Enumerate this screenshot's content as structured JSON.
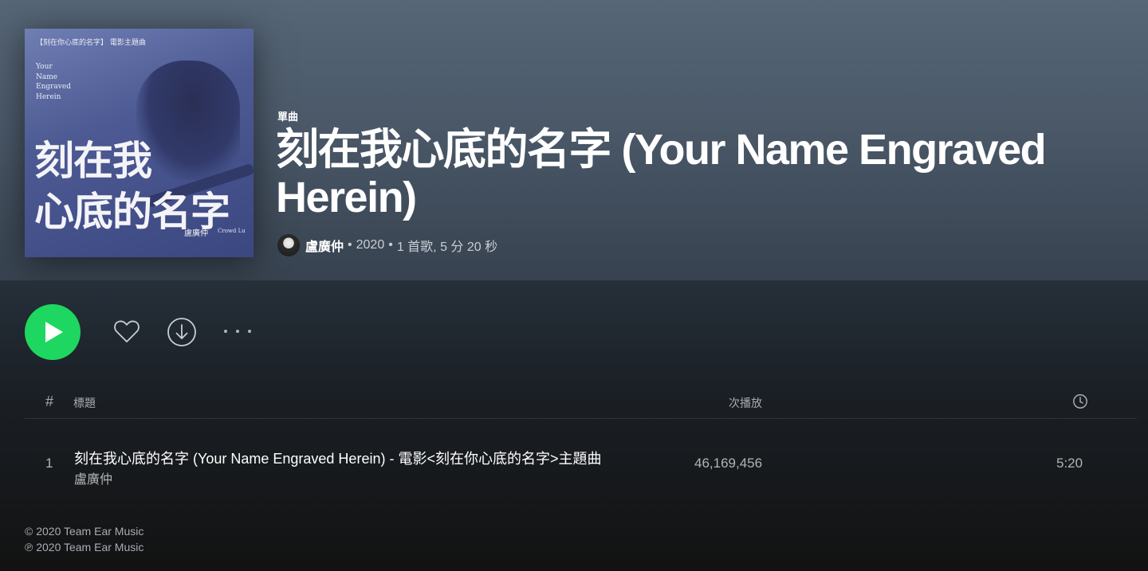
{
  "header": {
    "type_label": "單曲",
    "title": "刻在我心底的名字 (Your Name Engraved Herein)",
    "artist": "盧廣仲",
    "year": "2020",
    "summary": "1 首歌, 5 分 20 秒",
    "colors": {
      "gradient_top": "#566677",
      "gradient_bottom": "#37424f"
    }
  },
  "cover": {
    "top_text": "【刻在你心底的名字】 電影主題曲",
    "english_lines": [
      "Your",
      "Name",
      "Engraved",
      "Herein"
    ],
    "big_text_line1": "刻在我",
    "big_text_line2": "心底的名字",
    "artist_text": "盧廣仲",
    "artist_en": "Crowd Lu"
  },
  "actions": {
    "play_icon": "play-icon",
    "like_icon": "heart-icon",
    "download_icon": "download-icon",
    "more_icon": "more-icon",
    "accent": "#1ed760"
  },
  "table": {
    "headers": {
      "number": "#",
      "title": "標題",
      "plays": "次播放",
      "duration_icon": "clock-icon"
    },
    "tracks": [
      {
        "number": "1",
        "title": "刻在我心底的名字 (Your Name Engraved Herein) - 電影<刻在你心底的名字>主題曲",
        "artist": "盧廣仲",
        "plays": "46,169,456",
        "duration": "5:20"
      }
    ]
  },
  "footer": {
    "copyright": "© 2020 Team Ear Music",
    "phonogram": "℗ 2020 Team Ear Music"
  }
}
